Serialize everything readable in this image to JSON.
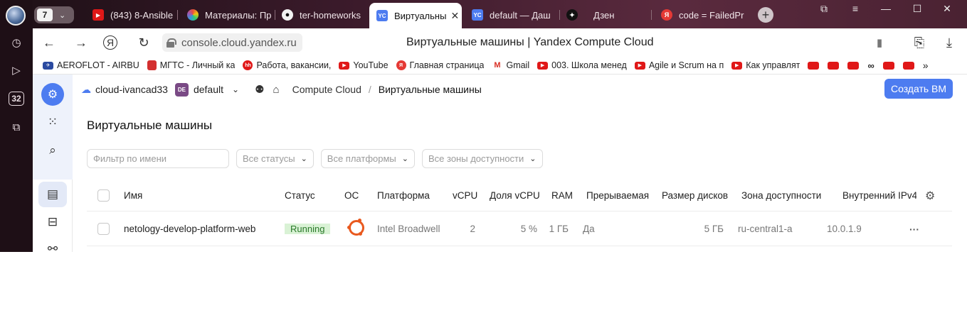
{
  "browser": {
    "tab_count": "7",
    "tabs": [
      {
        "label": "(843) 8-Ansible"
      },
      {
        "label": "Материалы: Пр"
      },
      {
        "label": "ter-homeworks"
      },
      {
        "label": "Виртуальны",
        "active": true,
        "favicon": "YC"
      },
      {
        "label": "default — Даш",
        "favicon": "YC"
      },
      {
        "label": "Дзен"
      },
      {
        "label": "code = FailedPr"
      }
    ],
    "url": "console.cloud.yandex.ru",
    "page_title": "Виртуальные машины | Yandex Compute Cloud",
    "sidebar_badge": "32",
    "bookmarks": [
      {
        "label": "AEROFLOT - AIRBU"
      },
      {
        "label": "МГТС - Личный ка"
      },
      {
        "label": "Работа, вакансии,"
      },
      {
        "label": "YouTube"
      },
      {
        "label": "Главная страница"
      },
      {
        "label": "Gmail"
      },
      {
        "label": "003. Школа менед"
      },
      {
        "label": "Agile и Scrum на п"
      },
      {
        "label": "Как управлят"
      }
    ],
    "bookmarks_more": "»"
  },
  "console": {
    "cloud": "cloud-ivancad33",
    "folder_badge": "DE",
    "folder": "default",
    "service": "Compute Cloud",
    "breadcrumb_sep": "/",
    "current": "Виртуальные машины",
    "create_button": "Создать ВМ",
    "heading": "Виртуальные машины",
    "filters": {
      "name_placeholder": "Фильтр по имени",
      "status": "Все статусы",
      "platform": "Все платформы",
      "zone": "Все зоны доступности"
    },
    "columns": [
      "Имя",
      "Статус",
      "ОС",
      "Платформа",
      "vCPU",
      "Доля vCPU",
      "RAM",
      "Прерываемая",
      "Размер дисков",
      "Зона доступности",
      "Внутренний IPv4"
    ],
    "rows": [
      {
        "name": "netology-develop-platform-web",
        "status": "Running",
        "os": "ubuntu-icon",
        "platform": "Intel Broadwell",
        "vcpu": "2",
        "core_fraction": "5 %",
        "ram": "1 ГБ",
        "preemptible": "Да",
        "disk": "5 ГБ",
        "zone": "ru-central1-a",
        "ip": "10.0.1.9",
        "menu": "···"
      }
    ]
  },
  "colors": {
    "accent": "#4d7cf0",
    "running_bg": "#d9f2d5",
    "running_text": "#2a7a2a",
    "ubuntu": "#e9591e"
  }
}
